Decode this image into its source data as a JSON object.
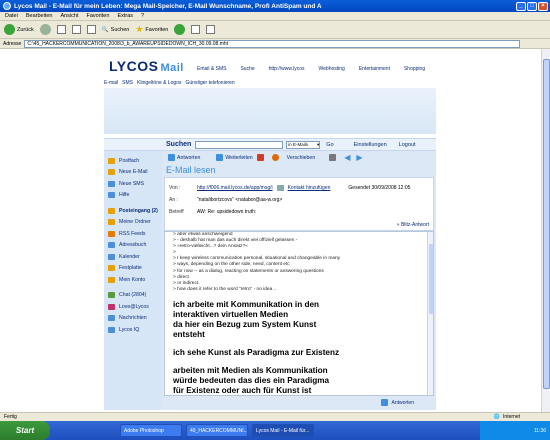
{
  "window": {
    "title": "Lycos Mail - E-Mail für mein Leben: Mega Mail-Speicher, E-Mail Wunschname, Profi AntiSpam und A",
    "min": "_",
    "max": "□",
    "close": "×"
  },
  "menu": [
    "Datei",
    "Bearbeiten",
    "Ansicht",
    "Favoriten",
    "Extras",
    "?"
  ],
  "toolbar": {
    "back": "Zurück",
    "search": "Suchen",
    "favorites": "Favoriten"
  },
  "address": {
    "label": "Adresse",
    "value": "C:\\45_HACKERCOMMUNICATION_2008\\3_b_AWAREUPSIDEDOWN_ICH_30.09.08.mht"
  },
  "lycos": {
    "logo": "LYCOS",
    "logo_sub": "Mail",
    "nav_top": [
      "Email & SMS",
      "Suche",
      "http://www.lycos",
      "Webhosting",
      "Entertainment",
      "Shopping"
    ],
    "nav_sub": [
      "E-mail",
      "SMS",
      "Klingeltöne & Logos",
      "Günstiger telefonieren"
    ]
  },
  "searchbar": {
    "label": "Suchen",
    "select": "in E-Mails",
    "go": "Go",
    "settings": "Einstellungen",
    "logout": "Logout"
  },
  "sidebar": {
    "items": [
      {
        "label": "Postfach",
        "color": "#e6a100"
      },
      {
        "label": "Neue E-Mail",
        "color": "#e6a100"
      },
      {
        "label": "Neue SMS",
        "color": "#4a90d9"
      },
      {
        "label": "Hilfe",
        "color": "#4a90d9"
      },
      {
        "label": "Posteingang (2)",
        "color": "#e6a100",
        "bold": true
      },
      {
        "label": "Meine Ordner",
        "color": "#e6a100"
      },
      {
        "label": "RSS Feeds",
        "color": "#e67a00"
      },
      {
        "label": "Adressbuch",
        "color": "#4a90d9"
      },
      {
        "label": "Kalender",
        "color": "#4a90d9"
      },
      {
        "label": "Festplatte",
        "color": "#e6a100"
      },
      {
        "label": "Mein Konto",
        "color": "#e6a100"
      },
      {
        "label": "Chat (2804)",
        "color": "#5a9a3a",
        "bold_part": true
      },
      {
        "label": "Love@Lycos",
        "color": "#c0306a"
      },
      {
        "label": "Nachrichten",
        "color": "#4a90d9"
      },
      {
        "label": "Lycos IQ",
        "color": "#4a90d9"
      }
    ]
  },
  "actions": {
    "reply": "Antworten",
    "forward": "Weiterleiten",
    "move": "Verschieben"
  },
  "email": {
    "heading": "E-Mail lesen",
    "from_label": "Von :",
    "from_value": "http://f006.mail.lycos.de/app/msg/i",
    "add_contact": "Kontakt hinzufügen",
    "sent": "Gesendet 30/09/2008 12:05",
    "to_label": "An :",
    "to_value": "\"natalibortzcovs\" <natabor@aa-w.org>",
    "subject_label": "Betreff",
    "subject_value": "AW: Re: upsidedown truth:",
    "quick_reply": "Blitz-Antwort",
    "quoted": [
      "> aber etwas anschweigend",
      "> - deshalb hat man das auch direkt viel offiziell gelassen -",
      "> »retro-vielleicht...? dein Ansatz?«",
      ">",
      "> I keep wireless communication personal, situational and changeable in many",
      "> ways, depending on the other side, need, content etc",
      "> for now -- as a dialog, reacting on statements or answering questions",
      "> direct",
      "> or indirect.",
      "> how does it refer to the word \"retro\" - no idea .."
    ],
    "body_1": [
      "ich arbeite mit Kommunikation in den",
      "interaktiven virtuellen Medien",
      "da hier ein Bezug zum System Kunst",
      "entsteht"
    ],
    "body_2": [
      "ich sehe Kunst als Paradigma zur Existenz"
    ],
    "body_3": [
      "arbeiten mit Medien als Kommunikation",
      "würde bedeuten das dies ein Paradigma",
      "für Existenz oder auch für Kunst ist"
    ],
    "bottom_reply": "Antworten"
  },
  "status": {
    "left": "Fertig",
    "zone": "Internet"
  },
  "taskbar": {
    "start": "Start",
    "tasks": [
      "Adobe Photoshop",
      "49_HACKERCOMMUNI...",
      "Lycos Mail - E-Mail für..."
    ],
    "clock": "11:36"
  }
}
